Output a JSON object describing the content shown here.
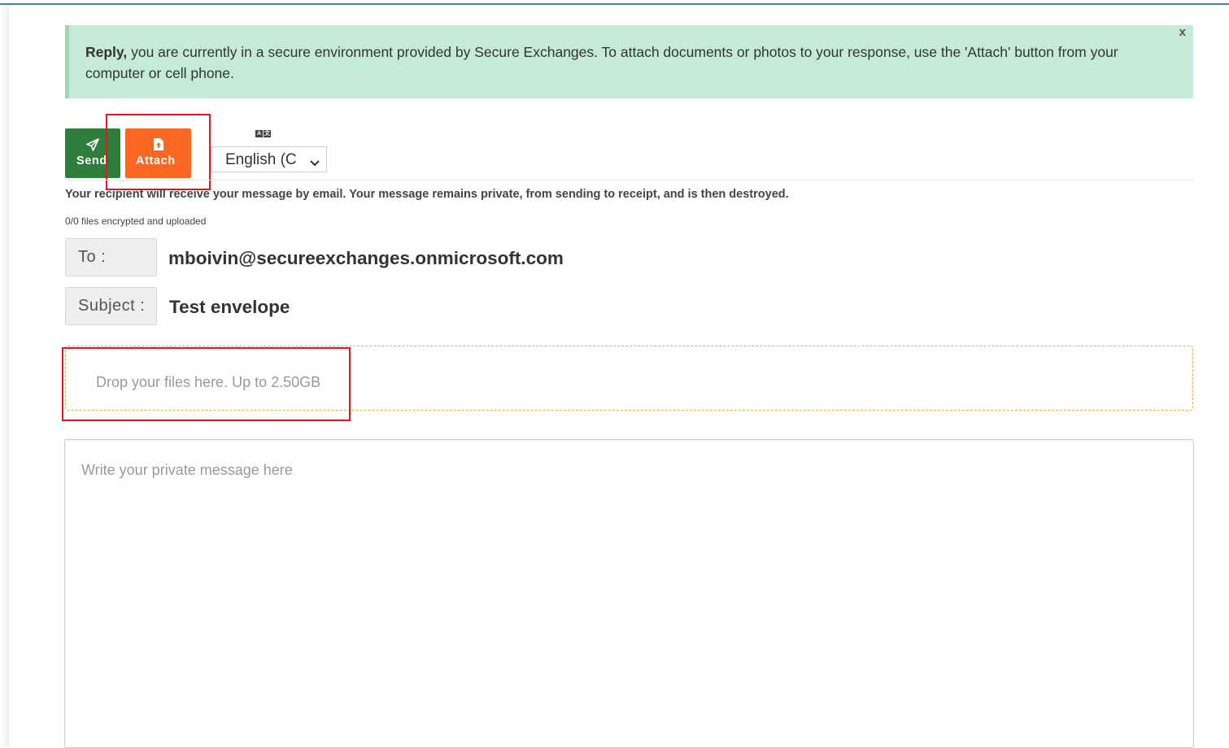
{
  "alert": {
    "strong": "Reply,",
    "text": " you are currently in a secure environment provided by Secure Exchanges. To attach documents or photos to your response, use the 'Attach' button from your computer or cell phone.",
    "close": "x",
    "background": "#c5ead5"
  },
  "toolbar": {
    "send_label": "Send",
    "send_icon": "paper-plane-icon",
    "send_color": "#2e7d3a",
    "attach_label": "Attach",
    "attach_icon": "file-upload-icon",
    "attach_color": "#fa6722",
    "language_icon": "translate-icon",
    "language_value": "English (C"
  },
  "info": {
    "privacy_text": "Your recipient will receive your message by email. Your message remains private, from sending to receipt, and is then destroyed.",
    "files_status": "0/0 files encrypted and uploaded"
  },
  "fields": {
    "to_label": "To :",
    "to_value": "mboivin@secureexchanges.onmicrosoft.com",
    "subject_label": "Subject :",
    "subject_value": "Test envelope"
  },
  "dropzone": {
    "text": "Drop your files here. Up to 2.50GB"
  },
  "message": {
    "placeholder": "Write your private message here"
  },
  "highlight_color": "#e8141b"
}
